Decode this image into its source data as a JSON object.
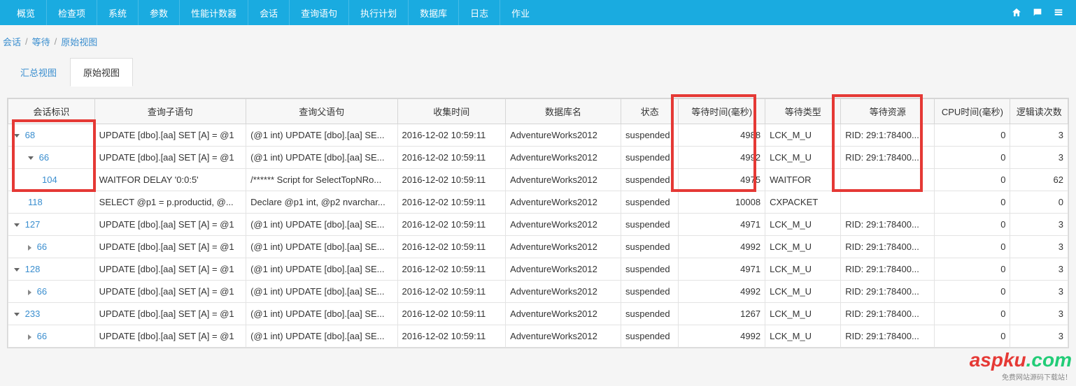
{
  "nav": [
    "概览",
    "检查项",
    "系统",
    "参数",
    "性能计数器",
    "会话",
    "查询语句",
    "执行计划",
    "数据库",
    "日志",
    "作业"
  ],
  "breadcrumb": {
    "a": "会话",
    "b": "等待",
    "c": "原始视图"
  },
  "tabs": {
    "summary": "汇总视图",
    "raw": "原始视图"
  },
  "columns": [
    "会话标识",
    "查询子语句",
    "查询父语句",
    "收集时间",
    "数据库名",
    "状态",
    "等待时间(毫秒)",
    "等待类型",
    "等待资源",
    "CPU时间(毫秒)",
    "逻辑读次数"
  ],
  "rows": [
    {
      "indent": 0,
      "arrow": "down",
      "sid": "68",
      "child": "UPDATE [dbo].[aa] SET [A] = @1",
      "parent": "(@1 int) UPDATE [dbo].[aa] SE...",
      "time": "2016-12-02 10:59:11",
      "db": "AdventureWorks2012",
      "status": "suspended",
      "wait": "4988",
      "wtype": "LCK_M_U",
      "wres": "RID: 29:1:78400...",
      "cpu": "0",
      "reads": "3"
    },
    {
      "indent": 1,
      "arrow": "down",
      "sid": "66",
      "child": "UPDATE [dbo].[aa] SET [A] = @1",
      "parent": "(@1 int) UPDATE [dbo].[aa] SE...",
      "time": "2016-12-02 10:59:11",
      "db": "AdventureWorks2012",
      "status": "suspended",
      "wait": "4992",
      "wtype": "LCK_M_U",
      "wres": "RID: 29:1:78400...",
      "cpu": "0",
      "reads": "3"
    },
    {
      "indent": 2,
      "arrow": "",
      "sid": "104",
      "child": "WAITFOR DELAY '0:0:5'",
      "parent": "/****** Script for SelectTopNRo...",
      "time": "2016-12-02 10:59:11",
      "db": "AdventureWorks2012",
      "status": "suspended",
      "wait": "4975",
      "wtype": "WAITFOR",
      "wres": "",
      "cpu": "0",
      "reads": "62"
    },
    {
      "indent": 1,
      "arrow": "",
      "sid": "118",
      "child": "SELECT @p1 = p.productid, @...",
      "parent": "Declare @p1 int, @p2 nvarchar...",
      "time": "2016-12-02 10:59:11",
      "db": "AdventureWorks2012",
      "status": "suspended",
      "wait": "10008",
      "wtype": "CXPACKET",
      "wres": "",
      "cpu": "0",
      "reads": "0"
    },
    {
      "indent": 0,
      "arrow": "down",
      "sid": "127",
      "child": "UPDATE [dbo].[aa] SET [A] = @1",
      "parent": "(@1 int) UPDATE [dbo].[aa] SE...",
      "time": "2016-12-02 10:59:11",
      "db": "AdventureWorks2012",
      "status": "suspended",
      "wait": "4971",
      "wtype": "LCK_M_U",
      "wres": "RID: 29:1:78400...",
      "cpu": "0",
      "reads": "3"
    },
    {
      "indent": 1,
      "arrow": "right",
      "sid": "66",
      "child": "UPDATE [dbo].[aa] SET [A] = @1",
      "parent": "(@1 int) UPDATE [dbo].[aa] SE...",
      "time": "2016-12-02 10:59:11",
      "db": "AdventureWorks2012",
      "status": "suspended",
      "wait": "4992",
      "wtype": "LCK_M_U",
      "wres": "RID: 29:1:78400...",
      "cpu": "0",
      "reads": "3"
    },
    {
      "indent": 0,
      "arrow": "down",
      "sid": "128",
      "child": "UPDATE [dbo].[aa] SET [A] = @1",
      "parent": "(@1 int) UPDATE [dbo].[aa] SE...",
      "time": "2016-12-02 10:59:11",
      "db": "AdventureWorks2012",
      "status": "suspended",
      "wait": "4971",
      "wtype": "LCK_M_U",
      "wres": "RID: 29:1:78400...",
      "cpu": "0",
      "reads": "3"
    },
    {
      "indent": 1,
      "arrow": "right",
      "sid": "66",
      "child": "UPDATE [dbo].[aa] SET [A] = @1",
      "parent": "(@1 int) UPDATE [dbo].[aa] SE...",
      "time": "2016-12-02 10:59:11",
      "db": "AdventureWorks2012",
      "status": "suspended",
      "wait": "4992",
      "wtype": "LCK_M_U",
      "wres": "RID: 29:1:78400...",
      "cpu": "0",
      "reads": "3"
    },
    {
      "indent": 0,
      "arrow": "down",
      "sid": "233",
      "child": "UPDATE [dbo].[aa] SET [A] = @1",
      "parent": "(@1 int) UPDATE [dbo].[aa] SE...",
      "time": "2016-12-02 10:59:11",
      "db": "AdventureWorks2012",
      "status": "suspended",
      "wait": "1267",
      "wtype": "LCK_M_U",
      "wres": "RID: 29:1:78400...",
      "cpu": "0",
      "reads": "3"
    },
    {
      "indent": 1,
      "arrow": "right",
      "sid": "66",
      "child": "UPDATE [dbo].[aa] SET [A] = @1",
      "parent": "(@1 int) UPDATE [dbo].[aa] SE...",
      "time": "2016-12-02 10:59:11",
      "db": "AdventureWorks2012",
      "status": "suspended",
      "wait": "4992",
      "wtype": "LCK_M_U",
      "wres": "RID: 29:1:78400...",
      "cpu": "0",
      "reads": "3"
    }
  ],
  "watermark": {
    "part1": "aspku",
    "part2": ".com",
    "sub": "免费网站源码下载站！"
  }
}
